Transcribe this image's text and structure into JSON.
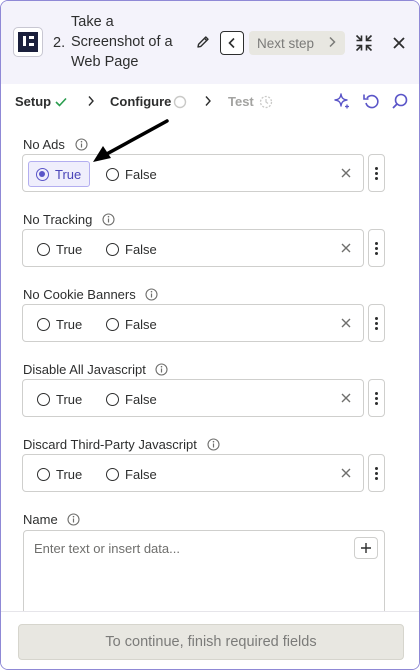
{
  "header": {
    "step_number": "2.",
    "step_title": "Take a Screenshot of a Web Page",
    "next_step_label": "Next step"
  },
  "tabs": [
    {
      "label": "Setup",
      "status": "complete"
    },
    {
      "label": "Configure",
      "status": "incomplete"
    },
    {
      "label": "Test",
      "status": "pending"
    }
  ],
  "fields": [
    {
      "label": "No Ads",
      "options": [
        "True",
        "False"
      ],
      "selected": "True"
    },
    {
      "label": "No Tracking",
      "options": [
        "True",
        "False"
      ],
      "selected": null
    },
    {
      "label": "No Cookie Banners",
      "options": [
        "True",
        "False"
      ],
      "selected": null
    },
    {
      "label": "Disable All Javascript",
      "options": [
        "True",
        "False"
      ],
      "selected": null
    },
    {
      "label": "Discard Third-Party Javascript",
      "options": [
        "True",
        "False"
      ],
      "selected": null
    }
  ],
  "name_field": {
    "label": "Name",
    "placeholder": "Enter text or insert data..."
  },
  "footer": {
    "continue_label": "To continue, finish required fields"
  },
  "colors": {
    "accent": "#5a55c8",
    "border_accent": "#8f89d6",
    "header_bg": "#f4f3fb",
    "success": "#2a9d4e"
  }
}
